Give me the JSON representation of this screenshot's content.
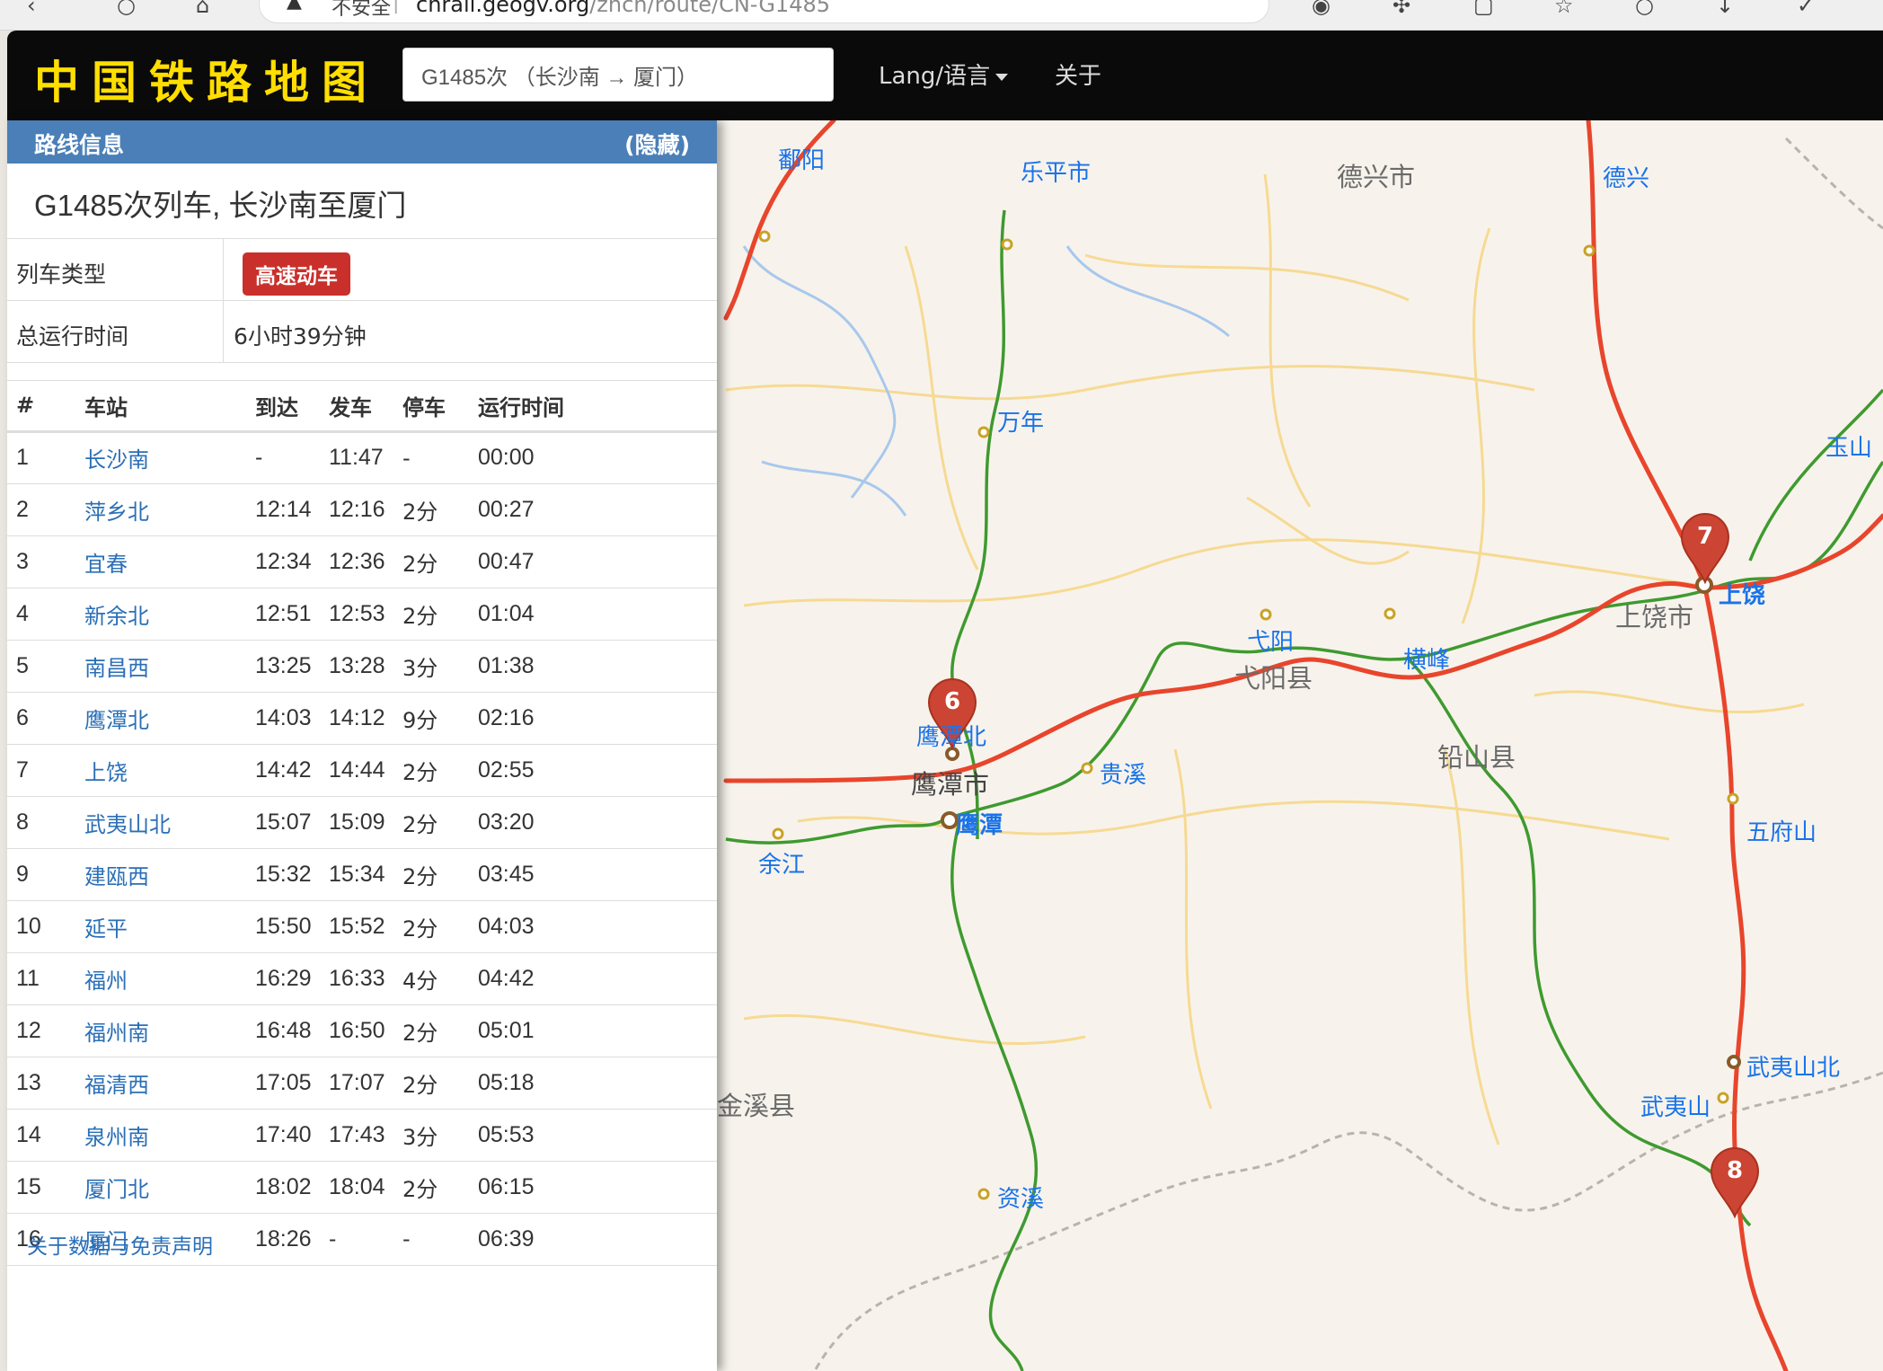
{
  "browser": {
    "security_label": "不安全",
    "url_host": "cnrail.geogv.org",
    "url_path": "/zhcn/route/CN-G1485"
  },
  "navbar": {
    "brand": "中国铁路地图",
    "search_value": "G1485次 （长沙南 → 厦门）",
    "lang_label": "Lang/语言",
    "about_label": "关于"
  },
  "sidebar": {
    "header_title": "路线信息",
    "hide_label": "(隐藏)",
    "train_title": "G1485次列车, 长沙南至厦门",
    "type_label": "列车类型",
    "type_badge": "高速动车",
    "total_time_label": "总运行时间",
    "total_time_value": "6小时39分钟",
    "columns": [
      "#",
      "车站",
      "到达",
      "发车",
      "停车",
      "运行时间"
    ],
    "stops": [
      {
        "no": "1",
        "station": "长沙南",
        "arr": "-",
        "dep": "11:47",
        "stop": "-",
        "run": "00:00"
      },
      {
        "no": "2",
        "station": "萍乡北",
        "arr": "12:14",
        "dep": "12:16",
        "stop": "2分",
        "run": "00:27"
      },
      {
        "no": "3",
        "station": "宜春",
        "arr": "12:34",
        "dep": "12:36",
        "stop": "2分",
        "run": "00:47"
      },
      {
        "no": "4",
        "station": "新余北",
        "arr": "12:51",
        "dep": "12:53",
        "stop": "2分",
        "run": "01:04"
      },
      {
        "no": "5",
        "station": "南昌西",
        "arr": "13:25",
        "dep": "13:28",
        "stop": "3分",
        "run": "01:38"
      },
      {
        "no": "6",
        "station": "鹰潭北",
        "arr": "14:03",
        "dep": "14:12",
        "stop": "9分",
        "run": "02:16"
      },
      {
        "no": "7",
        "station": "上饶",
        "arr": "14:42",
        "dep": "14:44",
        "stop": "2分",
        "run": "02:55"
      },
      {
        "no": "8",
        "station": "武夷山北",
        "arr": "15:07",
        "dep": "15:09",
        "stop": "2分",
        "run": "03:20"
      },
      {
        "no": "9",
        "station": "建瓯西",
        "arr": "15:32",
        "dep": "15:34",
        "stop": "2分",
        "run": "03:45"
      },
      {
        "no": "10",
        "station": "延平",
        "arr": "15:50",
        "dep": "15:52",
        "stop": "2分",
        "run": "04:03"
      },
      {
        "no": "11",
        "station": "福州",
        "arr": "16:29",
        "dep": "16:33",
        "stop": "4分",
        "run": "04:42"
      },
      {
        "no": "12",
        "station": "福州南",
        "arr": "16:48",
        "dep": "16:50",
        "stop": "2分",
        "run": "05:01"
      },
      {
        "no": "13",
        "station": "福清西",
        "arr": "17:05",
        "dep": "17:07",
        "stop": "2分",
        "run": "05:18"
      },
      {
        "no": "14",
        "station": "泉州南",
        "arr": "17:40",
        "dep": "17:43",
        "stop": "3分",
        "run": "05:53"
      },
      {
        "no": "15",
        "station": "厦门北",
        "arr": "18:02",
        "dep": "18:04",
        "stop": "2分",
        "run": "06:15"
      },
      {
        "no": "16",
        "station": "厦门",
        "arr": "18:26",
        "dep": "-",
        "stop": "-",
        "run": "06:39"
      }
    ],
    "footer_link": "关于数据与免责声明"
  },
  "map": {
    "labels": {
      "poyang": "鄱阳",
      "lepingshi": "乐平市",
      "dexingshi": "德兴市",
      "dexing": "德兴",
      "wannian": "万年",
      "yushan": "玉山",
      "shangraoshi": "上饶市",
      "shangrao": "上饶",
      "yiyang": "弋阳",
      "yiyangxian": "弋阳县",
      "hengfeng": "横峰",
      "yingtanbei": "鹰潭北",
      "yingtanshi": "鹰潭市",
      "yingtan": "鹰潭",
      "guixi": "贵溪",
      "yanshanxian": "铅山县",
      "wufushan": "五府山",
      "yujiang": "余江",
      "jinxixian": "金溪县",
      "wuyishanbei": "武夷山北",
      "wuyishan": "武夷山",
      "zixi": "资溪"
    },
    "pins": [
      "6",
      "7",
      "8"
    ],
    "route_color": "#e8452c",
    "rail_color": "#3f9a2f"
  }
}
